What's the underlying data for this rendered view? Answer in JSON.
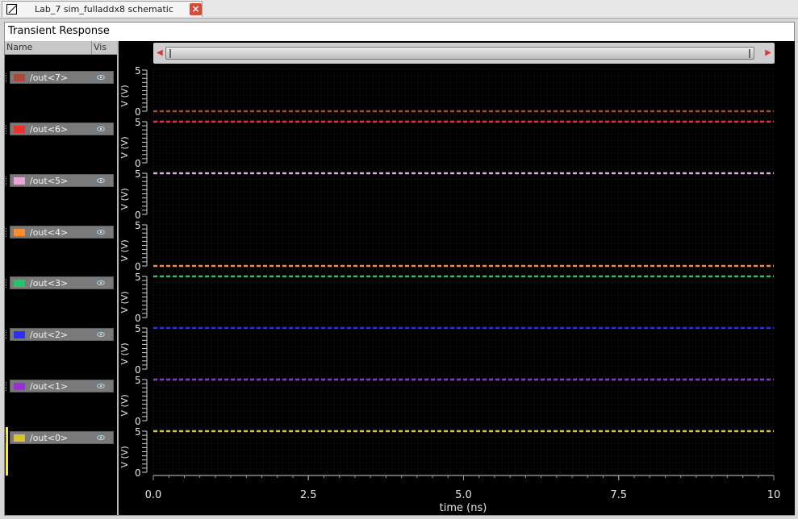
{
  "window": {
    "tab_title": "Lab_7 sim_fulladdx8 schematic",
    "panel_title": "Transient Response"
  },
  "columns": {
    "name": "Name",
    "vis": "Vis"
  },
  "signals": [
    {
      "name": "/out<7>",
      "color": "#b2463b",
      "level": 0,
      "visible": true
    },
    {
      "name": "/out<6>",
      "color": "#f02f2f",
      "level": 5,
      "visible": true
    },
    {
      "name": "/out<5>",
      "color": "#e6a8d8",
      "level": 5,
      "visible": true
    },
    {
      "name": "/out<4>",
      "color": "#ff8a2a",
      "level": 0,
      "visible": true
    },
    {
      "name": "/out<3>",
      "color": "#25c46b",
      "level": 5,
      "visible": true
    },
    {
      "name": "/out<2>",
      "color": "#2b2fff",
      "level": 5,
      "visible": true
    },
    {
      "name": "/out<1>",
      "color": "#9c2fd8",
      "level": 5,
      "visible": true
    },
    {
      "name": "/out<0>",
      "color": "#d7c52d",
      "level": 5,
      "visible": true
    }
  ],
  "chart_data": {
    "type": "line",
    "xlabel": "time (ns)",
    "ylabel": "V (V)",
    "x_ticks": [
      "0.0",
      "2.5",
      "5.0",
      "7.5",
      "10"
    ],
    "xlim": [
      0,
      10
    ],
    "ylim": [
      0,
      5
    ],
    "y_ticks": [
      "0",
      "5"
    ],
    "grid": true,
    "series": [
      {
        "name": "/out<7>",
        "x": [
          0,
          10
        ],
        "y": [
          0,
          0
        ]
      },
      {
        "name": "/out<6>",
        "x": [
          0,
          10
        ],
        "y": [
          5,
          5
        ]
      },
      {
        "name": "/out<5>",
        "x": [
          0,
          10
        ],
        "y": [
          5,
          5
        ]
      },
      {
        "name": "/out<4>",
        "x": [
          0,
          10
        ],
        "y": [
          0,
          0
        ]
      },
      {
        "name": "/out<3>",
        "x": [
          0,
          10
        ],
        "y": [
          5,
          5
        ]
      },
      {
        "name": "/out<2>",
        "x": [
          0,
          10
        ],
        "y": [
          5,
          5
        ]
      },
      {
        "name": "/out<1>",
        "x": [
          0,
          10
        ],
        "y": [
          5,
          5
        ]
      },
      {
        "name": "/out<0>",
        "x": [
          0,
          10
        ],
        "y": [
          5,
          5
        ]
      }
    ]
  },
  "icons": {
    "tab": "schematic-icon",
    "close": "close-icon",
    "visibility": "eye-icon"
  }
}
